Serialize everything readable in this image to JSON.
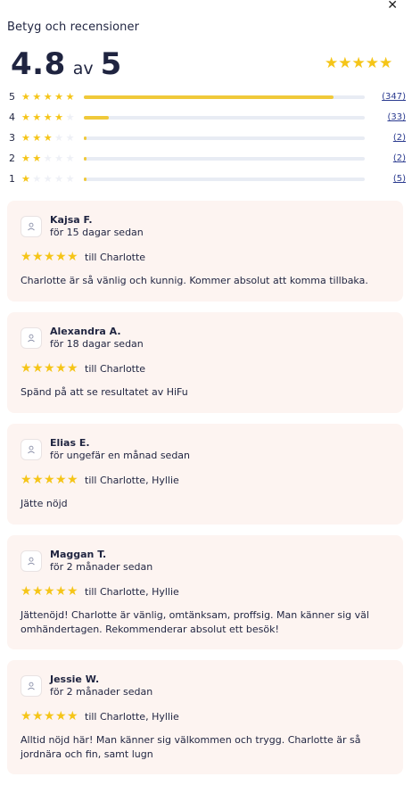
{
  "close_icon": "✕",
  "title": "Betyg och recensioner",
  "summary": {
    "score": "4.8",
    "av": "av",
    "max": "5",
    "stars_filled": 5
  },
  "distribution": [
    {
      "stars": "5",
      "count": "(347)",
      "fill_fraction": 0.89,
      "filled": 5
    },
    {
      "stars": "4",
      "count": "(33)",
      "fill_fraction": 0.09,
      "filled": 4
    },
    {
      "stars": "3",
      "count": "(2)",
      "fill_fraction": 0.01,
      "filled": 3
    },
    {
      "stars": "2",
      "count": "(2)",
      "fill_fraction": 0.01,
      "filled": 2
    },
    {
      "stars": "1",
      "count": "(5)",
      "fill_fraction": 0.01,
      "filled": 1
    }
  ],
  "reviews": [
    {
      "name": "Kajsa F.",
      "when": "för 15 dagar sedan",
      "to": "till Charlotte",
      "text": "Charlotte är så vänlig och kunnig. Kommer absolut att komma tillbaka.",
      "stars": 5
    },
    {
      "name": "Alexandra A.",
      "when": "för 18 dagar sedan",
      "to": "till Charlotte",
      "text": "Spänd på att se resultatet av HiFu",
      "stars": 5
    },
    {
      "name": "Elias E.",
      "when": "för ungefär en månad sedan",
      "to": "till Charlotte, Hyllie",
      "text": "Jätte nöjd",
      "stars": 5
    },
    {
      "name": "Maggan T.",
      "when": "för 2 månader sedan",
      "to": "till Charlotte, Hyllie",
      "text": "Jättenöjd! Charlotte är vänlig, omtänksam, proffsig. Man känner sig väl omhändertagen. Rekommenderar absolut ett besök!",
      "stars": 5
    },
    {
      "name": "Jessie W.",
      "when": "för 2 månader sedan",
      "to": "till Charlotte, Hyllie",
      "text": "Alltid nöjd här! Man känner sig välkommen och trygg. Charlotte är så jordnära och fin, samt lugn",
      "stars": 5
    }
  ],
  "colors": {
    "star": "#f5c518",
    "card": "#fdf4f1",
    "link": "#2a3a8f"
  }
}
